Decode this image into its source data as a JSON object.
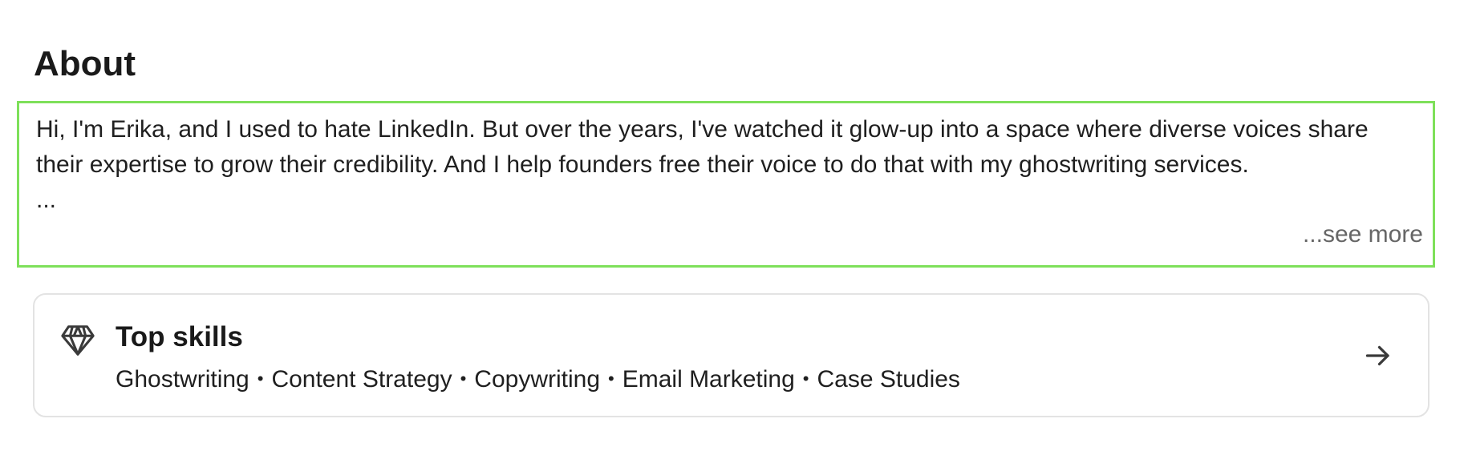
{
  "about": {
    "title": "About",
    "text": "Hi, I'm Erika, and I used to hate LinkedIn. But over the years, I've watched it glow-up into a space where diverse voices share their expertise to grow their credibility. And I help founders free their voice to do that with my ghostwriting services.",
    "ellipsis": "...",
    "see_more": "...see more"
  },
  "top_skills": {
    "title": "Top skills",
    "icon": "diamond-icon",
    "arrow_icon": "arrow-right-icon",
    "skills": [
      "Ghostwriting",
      "Content Strategy",
      "Copywriting",
      "Email Marketing",
      "Case Studies"
    ]
  },
  "colors": {
    "highlight_border": "#7ee05a",
    "muted_text": "#666666",
    "card_border": "#e3e3e3"
  }
}
